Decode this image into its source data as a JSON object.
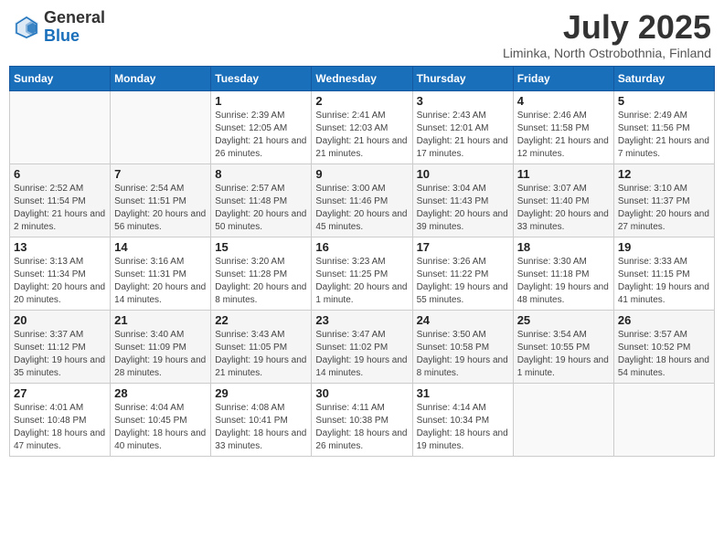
{
  "header": {
    "logo_general": "General",
    "logo_blue": "Blue",
    "title": "July 2025",
    "subtitle": "Liminka, North Ostrobothnia, Finland"
  },
  "weekdays": [
    "Sunday",
    "Monday",
    "Tuesday",
    "Wednesday",
    "Thursday",
    "Friday",
    "Saturday"
  ],
  "weeks": [
    [
      {
        "day": "",
        "info": ""
      },
      {
        "day": "",
        "info": ""
      },
      {
        "day": "1",
        "info": "Sunrise: 2:39 AM\nSunset: 12:05 AM\nDaylight: 21 hours and 26 minutes."
      },
      {
        "day": "2",
        "info": "Sunrise: 2:41 AM\nSunset: 12:03 AM\nDaylight: 21 hours and 21 minutes."
      },
      {
        "day": "3",
        "info": "Sunrise: 2:43 AM\nSunset: 12:01 AM\nDaylight: 21 hours and 17 minutes."
      },
      {
        "day": "4",
        "info": "Sunrise: 2:46 AM\nSunset: 11:58 PM\nDaylight: 21 hours and 12 minutes."
      },
      {
        "day": "5",
        "info": "Sunrise: 2:49 AM\nSunset: 11:56 PM\nDaylight: 21 hours and 7 minutes."
      }
    ],
    [
      {
        "day": "6",
        "info": "Sunrise: 2:52 AM\nSunset: 11:54 PM\nDaylight: 21 hours and 2 minutes."
      },
      {
        "day": "7",
        "info": "Sunrise: 2:54 AM\nSunset: 11:51 PM\nDaylight: 20 hours and 56 minutes."
      },
      {
        "day": "8",
        "info": "Sunrise: 2:57 AM\nSunset: 11:48 PM\nDaylight: 20 hours and 50 minutes."
      },
      {
        "day": "9",
        "info": "Sunrise: 3:00 AM\nSunset: 11:46 PM\nDaylight: 20 hours and 45 minutes."
      },
      {
        "day": "10",
        "info": "Sunrise: 3:04 AM\nSunset: 11:43 PM\nDaylight: 20 hours and 39 minutes."
      },
      {
        "day": "11",
        "info": "Sunrise: 3:07 AM\nSunset: 11:40 PM\nDaylight: 20 hours and 33 minutes."
      },
      {
        "day": "12",
        "info": "Sunrise: 3:10 AM\nSunset: 11:37 PM\nDaylight: 20 hours and 27 minutes."
      }
    ],
    [
      {
        "day": "13",
        "info": "Sunrise: 3:13 AM\nSunset: 11:34 PM\nDaylight: 20 hours and 20 minutes."
      },
      {
        "day": "14",
        "info": "Sunrise: 3:16 AM\nSunset: 11:31 PM\nDaylight: 20 hours and 14 minutes."
      },
      {
        "day": "15",
        "info": "Sunrise: 3:20 AM\nSunset: 11:28 PM\nDaylight: 20 hours and 8 minutes."
      },
      {
        "day": "16",
        "info": "Sunrise: 3:23 AM\nSunset: 11:25 PM\nDaylight: 20 hours and 1 minute."
      },
      {
        "day": "17",
        "info": "Sunrise: 3:26 AM\nSunset: 11:22 PM\nDaylight: 19 hours and 55 minutes."
      },
      {
        "day": "18",
        "info": "Sunrise: 3:30 AM\nSunset: 11:18 PM\nDaylight: 19 hours and 48 minutes."
      },
      {
        "day": "19",
        "info": "Sunrise: 3:33 AM\nSunset: 11:15 PM\nDaylight: 19 hours and 41 minutes."
      }
    ],
    [
      {
        "day": "20",
        "info": "Sunrise: 3:37 AM\nSunset: 11:12 PM\nDaylight: 19 hours and 35 minutes."
      },
      {
        "day": "21",
        "info": "Sunrise: 3:40 AM\nSunset: 11:09 PM\nDaylight: 19 hours and 28 minutes."
      },
      {
        "day": "22",
        "info": "Sunrise: 3:43 AM\nSunset: 11:05 PM\nDaylight: 19 hours and 21 minutes."
      },
      {
        "day": "23",
        "info": "Sunrise: 3:47 AM\nSunset: 11:02 PM\nDaylight: 19 hours and 14 minutes."
      },
      {
        "day": "24",
        "info": "Sunrise: 3:50 AM\nSunset: 10:58 PM\nDaylight: 19 hours and 8 minutes."
      },
      {
        "day": "25",
        "info": "Sunrise: 3:54 AM\nSunset: 10:55 PM\nDaylight: 19 hours and 1 minute."
      },
      {
        "day": "26",
        "info": "Sunrise: 3:57 AM\nSunset: 10:52 PM\nDaylight: 18 hours and 54 minutes."
      }
    ],
    [
      {
        "day": "27",
        "info": "Sunrise: 4:01 AM\nSunset: 10:48 PM\nDaylight: 18 hours and 47 minutes."
      },
      {
        "day": "28",
        "info": "Sunrise: 4:04 AM\nSunset: 10:45 PM\nDaylight: 18 hours and 40 minutes."
      },
      {
        "day": "29",
        "info": "Sunrise: 4:08 AM\nSunset: 10:41 PM\nDaylight: 18 hours and 33 minutes."
      },
      {
        "day": "30",
        "info": "Sunrise: 4:11 AM\nSunset: 10:38 PM\nDaylight: 18 hours and 26 minutes."
      },
      {
        "day": "31",
        "info": "Sunrise: 4:14 AM\nSunset: 10:34 PM\nDaylight: 18 hours and 19 minutes."
      },
      {
        "day": "",
        "info": ""
      },
      {
        "day": "",
        "info": ""
      }
    ]
  ]
}
